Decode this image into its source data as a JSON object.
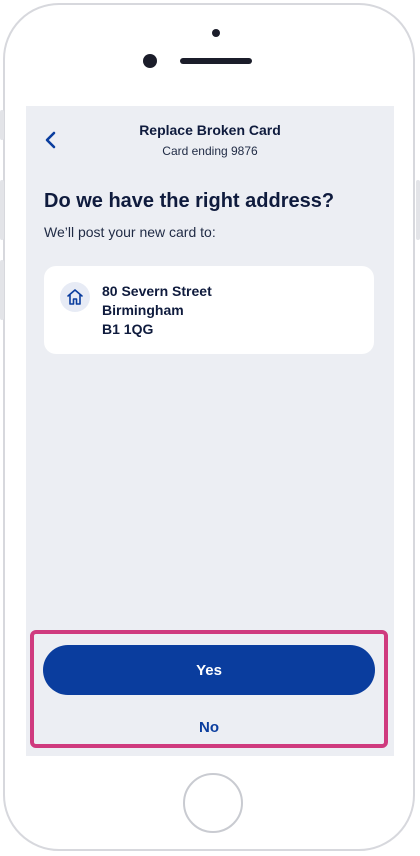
{
  "header": {
    "title": "Replace Broken Card",
    "subtitle": "Card ending 9876",
    "back_icon": "chevron-left-icon"
  },
  "main": {
    "heading": "Do we have the right address?",
    "subtext": "We’ll post your new card to:",
    "address": {
      "icon": "home-icon",
      "line1": "80 Severn Street",
      "line2": "Birmingham",
      "line3": "B1 1QG"
    }
  },
  "actions": {
    "yes_label": "Yes",
    "no_label": "No"
  },
  "colors": {
    "brand": "#0a3d9e",
    "highlight": "#cf3a7e",
    "screen_bg": "#eceef3",
    "text_dark": "#0f1b3d"
  }
}
